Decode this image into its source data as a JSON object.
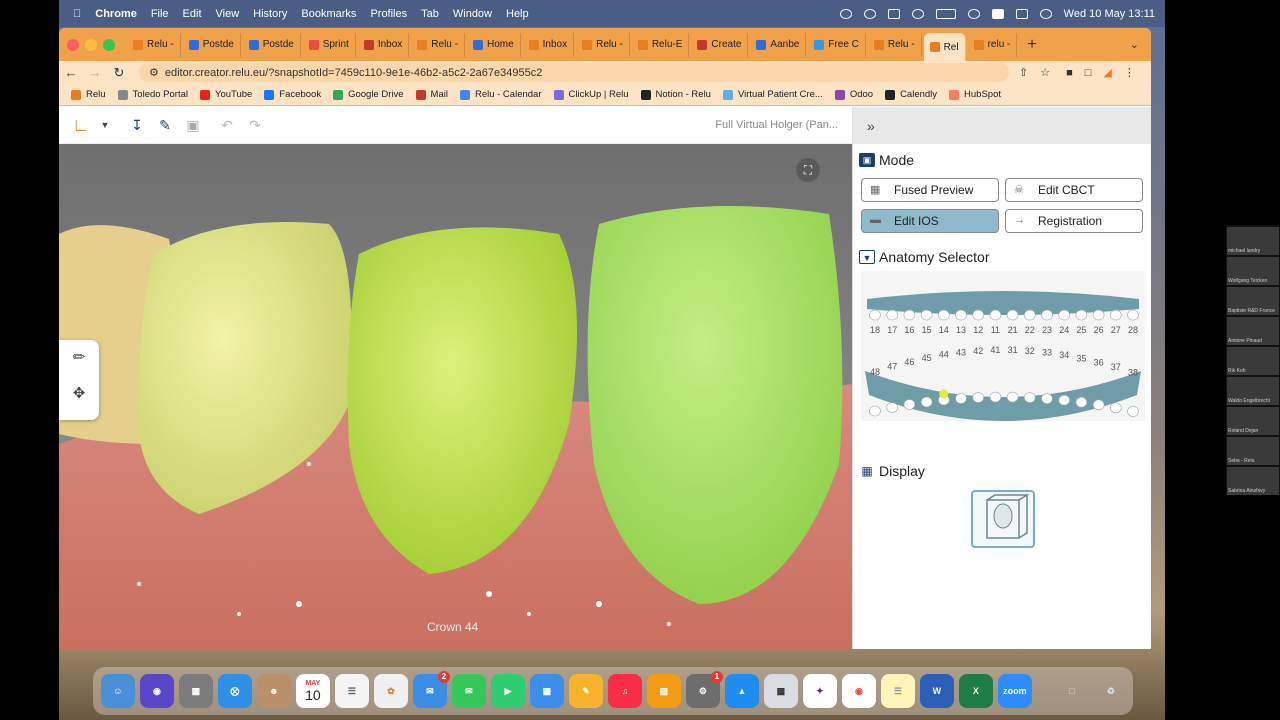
{
  "menubar": {
    "app": "Chrome",
    "items": [
      "File",
      "Edit",
      "View",
      "History",
      "Bookmarks",
      "Profiles",
      "Tab",
      "Window",
      "Help"
    ],
    "clock": "Wed 10 May  13:11"
  },
  "tabs": [
    {
      "label": "Relu -",
      "color": "#e67e22"
    },
    {
      "label": "Postde",
      "color": "#2d6cdf"
    },
    {
      "label": "Postde",
      "color": "#2d6cdf"
    },
    {
      "label": "Sprint",
      "color": "#e74c3c"
    },
    {
      "label": "Inbox",
      "color": "#c0392b"
    },
    {
      "label": "Relu -",
      "color": "#e67e22"
    },
    {
      "label": "Home",
      "color": "#2d6cdf"
    },
    {
      "label": "Inbox",
      "color": "#e67e22"
    },
    {
      "label": "Relu -",
      "color": "#e67e22"
    },
    {
      "label": "Relu-E",
      "color": "#e67e22"
    },
    {
      "label": "Create",
      "color": "#c0392b"
    },
    {
      "label": "Aanbe",
      "color": "#2d6cdf"
    },
    {
      "label": "Free C",
      "color": "#3498db"
    },
    {
      "label": "Relu -",
      "color": "#e67e22"
    },
    {
      "label": "Rel",
      "color": "#e67e22"
    },
    {
      "label": "relu -",
      "color": "#e67e22"
    }
  ],
  "address": {
    "url": "editor.creator.relu.eu/?snapshotId=7459c110-9e1e-46b2-a5c2-2a67e34955c2"
  },
  "bookmarks": [
    {
      "label": "Relu",
      "color": "#e67e22"
    },
    {
      "label": "Toledo Portal",
      "color": "#888"
    },
    {
      "label": "YouTube",
      "color": "#e62117"
    },
    {
      "label": "Facebook",
      "color": "#1877f2"
    },
    {
      "label": "Google Drive",
      "color": "#34a853"
    },
    {
      "label": "Mail",
      "color": "#c0392b"
    },
    {
      "label": "Relu - Calendar",
      "color": "#4285f4"
    },
    {
      "label": "ClickUp | Relu",
      "color": "#7b68ee"
    },
    {
      "label": "Notion - Relu",
      "color": "#222"
    },
    {
      "label": "Virtual Patient Cre...",
      "color": "#5dade2"
    },
    {
      "label": "Odoo",
      "color": "#8e44ad"
    },
    {
      "label": "Calendly",
      "color": "#222"
    },
    {
      "label": "HubSpot",
      "color": "#ff7a59"
    }
  ],
  "editor": {
    "document_title": "Full Virtual Holger (Pan...",
    "crown_label": "Crown 44"
  },
  "panel": {
    "mode_title": "Mode",
    "mode_buttons": [
      {
        "label": "Fused Preview",
        "active": false
      },
      {
        "label": "Edit CBCT",
        "active": false
      },
      {
        "label": "Edit IOS",
        "active": true
      },
      {
        "label": "Registration",
        "active": false
      }
    ],
    "anatomy_title": "Anatomy Selector",
    "upper_teeth": [
      "18",
      "17",
      "16",
      "15",
      "14",
      "13",
      "12",
      "11",
      "21",
      "22",
      "23",
      "24",
      "25",
      "26",
      "27",
      "28"
    ],
    "lower_teeth": [
      "48",
      "47",
      "46",
      "45",
      "44",
      "43",
      "42",
      "41",
      "31",
      "32",
      "33",
      "34",
      "35",
      "36",
      "37",
      "38"
    ],
    "selected_tooth": "44",
    "display_title": "Display"
  },
  "dock": {
    "calendar_month": "MAY",
    "calendar_day": "10",
    "mail_badge": "2",
    "settings_badge": "1",
    "zoom_label": "zoom"
  },
  "participants": [
    "michael landry",
    "Wolfgang Teicken",
    "Baptiste R&D France",
    "Antoine Pinaud",
    "Rik Koh",
    "Waldo Engelbrecht",
    "Roland Dejan",
    "Seba - Relu",
    "Sabrina Ainsfavy"
  ]
}
